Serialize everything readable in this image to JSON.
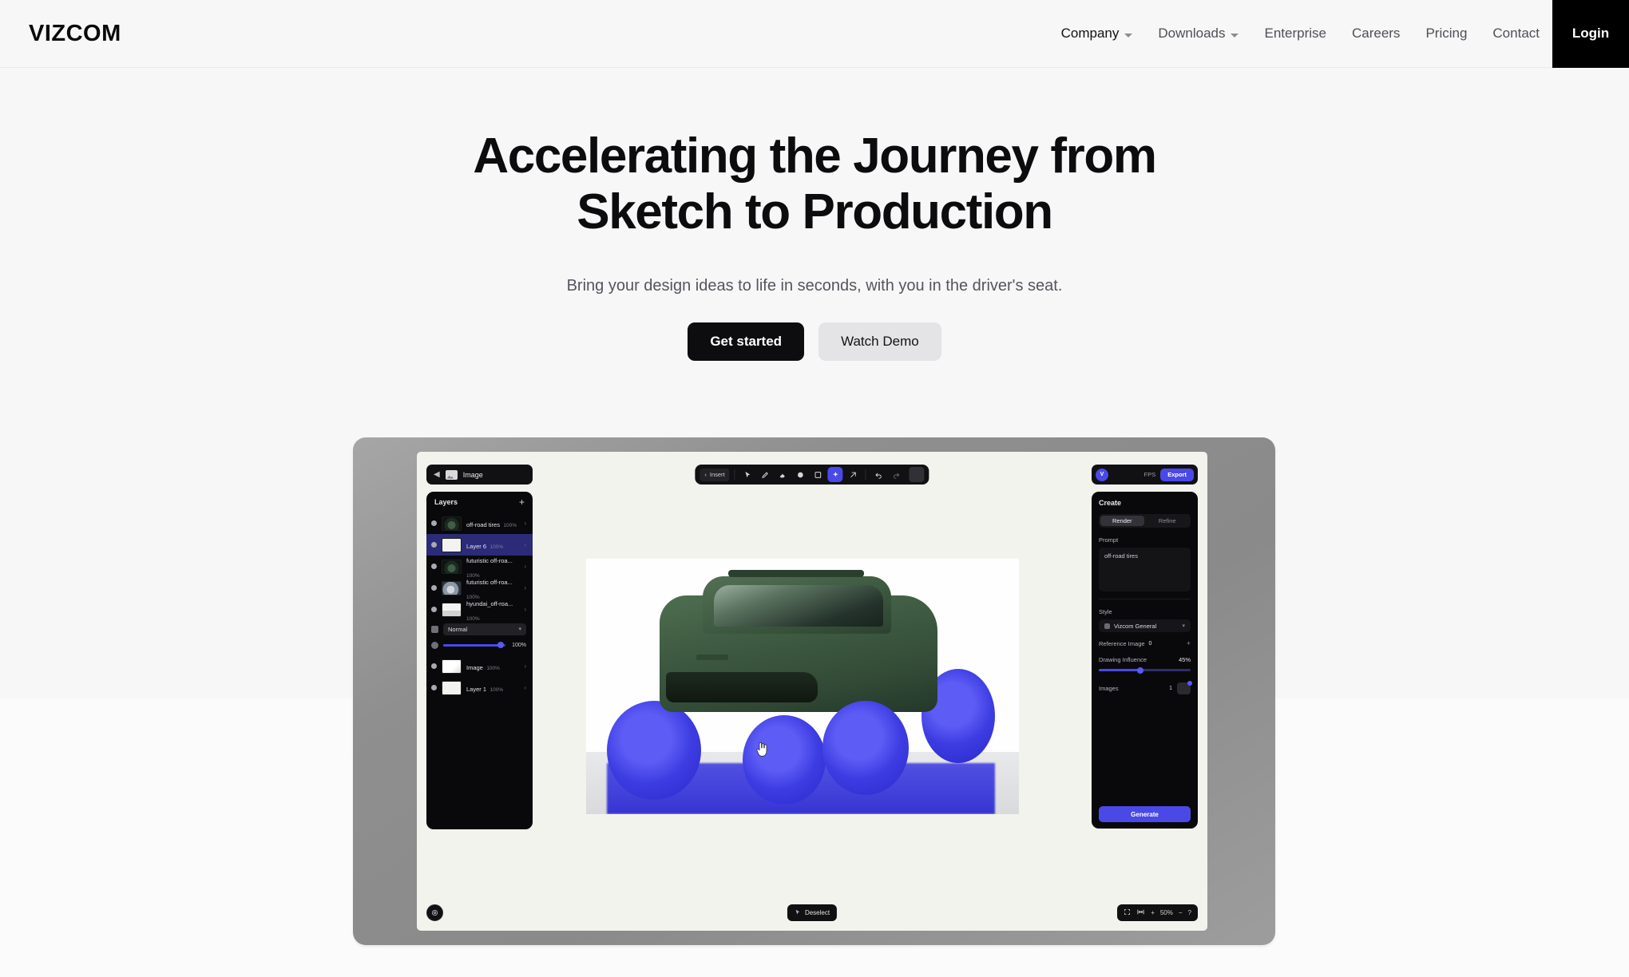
{
  "nav": {
    "brand": "VIZCOM",
    "items": [
      {
        "label": "Company",
        "has_chevron": true,
        "emphasis": true
      },
      {
        "label": "Downloads",
        "has_chevron": true,
        "emphasis": false
      },
      {
        "label": "Enterprise",
        "has_chevron": false,
        "emphasis": false
      },
      {
        "label": "Careers",
        "has_chevron": false,
        "emphasis": false
      },
      {
        "label": "Pricing",
        "has_chevron": false,
        "emphasis": false
      },
      {
        "label": "Contact",
        "has_chevron": false,
        "emphasis": false
      }
    ],
    "login_label": "Login"
  },
  "hero": {
    "title_line1": "Accelerating the Journey from",
    "title_line2": "Sketch to Production",
    "subtitle": "Bring your design ideas to life in seconds, with you in the driver's seat.",
    "primary_cta": "Get started",
    "secondary_cta": "Watch Demo"
  },
  "app": {
    "document_tag": {
      "back_icon": "back-arrow-icon",
      "thumb_icon": "image-thumbnail-icon",
      "label": "Image"
    },
    "layers_panel": {
      "title": "Layers",
      "add_icon": "plus-icon",
      "layers": [
        {
          "name": "off-road tires",
          "opacity": "100%",
          "thumb": "car",
          "selected": false
        },
        {
          "name": "Layer 6",
          "opacity": "100%",
          "thumb": "white",
          "selected": true
        },
        {
          "name": "futuristic off-roa...",
          "opacity": "100%",
          "thumb": "car",
          "selected": false
        },
        {
          "name": "futuristic off-roa...",
          "opacity": "100%",
          "thumb": "car2",
          "selected": false
        },
        {
          "name": "hyundai_off-roa...",
          "opacity": "100%",
          "thumb": "car3",
          "selected": false
        }
      ],
      "blend_mode": "Normal",
      "opacity_label": "100%",
      "layers_below": [
        {
          "name": "Image",
          "opacity": "100%",
          "thumb": "img",
          "selected": false
        },
        {
          "name": "Layer 1",
          "opacity": "100%",
          "thumb": "white",
          "selected": false
        }
      ]
    },
    "toolbar": {
      "back_label": "Insert",
      "tools": [
        {
          "icon": "select-cursor-icon",
          "active": false
        },
        {
          "icon": "pen-icon",
          "active": false
        },
        {
          "icon": "eraser-icon",
          "active": false
        },
        {
          "icon": "shape-icon",
          "active": false
        },
        {
          "icon": "frame-icon",
          "active": false
        },
        {
          "icon": "magic-wand-icon",
          "active": true
        },
        {
          "icon": "mask-icon",
          "active": false
        },
        {
          "icon": "undo-icon",
          "active": false
        },
        {
          "icon": "redo-icon",
          "active": false
        }
      ]
    },
    "top_right": {
      "avatar_initial": "V",
      "fps": "FPS",
      "export_label": "Export"
    },
    "create_panel": {
      "title": "Create",
      "tabs": [
        {
          "label": "Render",
          "active": true
        },
        {
          "label": "Refine",
          "active": false
        }
      ],
      "prompt_label": "Prompt",
      "prompt_value": "off-road tires",
      "style_label": "Style",
      "style_value": "Vizcom General",
      "reference_image_label": "Reference Image",
      "reference_image_count": "0",
      "drawing_influence_label": "Drawing Influence",
      "drawing_influence_value": "45%",
      "images_label": "Images",
      "images_count": "1",
      "generate_label": "Generate"
    },
    "status_bar": {
      "settings_icon": "gear-icon",
      "deselect_label": "Deselect",
      "zoom_fit_icon": "fit-to-screen-icon",
      "zoom_value": "50%",
      "zoom_in_icon": "plus-icon",
      "zoom_out_icon": "minus-icon",
      "help_icon": "help-icon"
    },
    "canvas": {
      "artwork_description": "green off-road concept truck with blue masked wheels",
      "cursor_icon": "pointing-hand-cursor"
    }
  },
  "colors": {
    "accent_blue": "#4a49e8",
    "page_bg": "#f7f7f8",
    "dark_panel": "#09090b",
    "device_frame": "#8a8a8a"
  }
}
